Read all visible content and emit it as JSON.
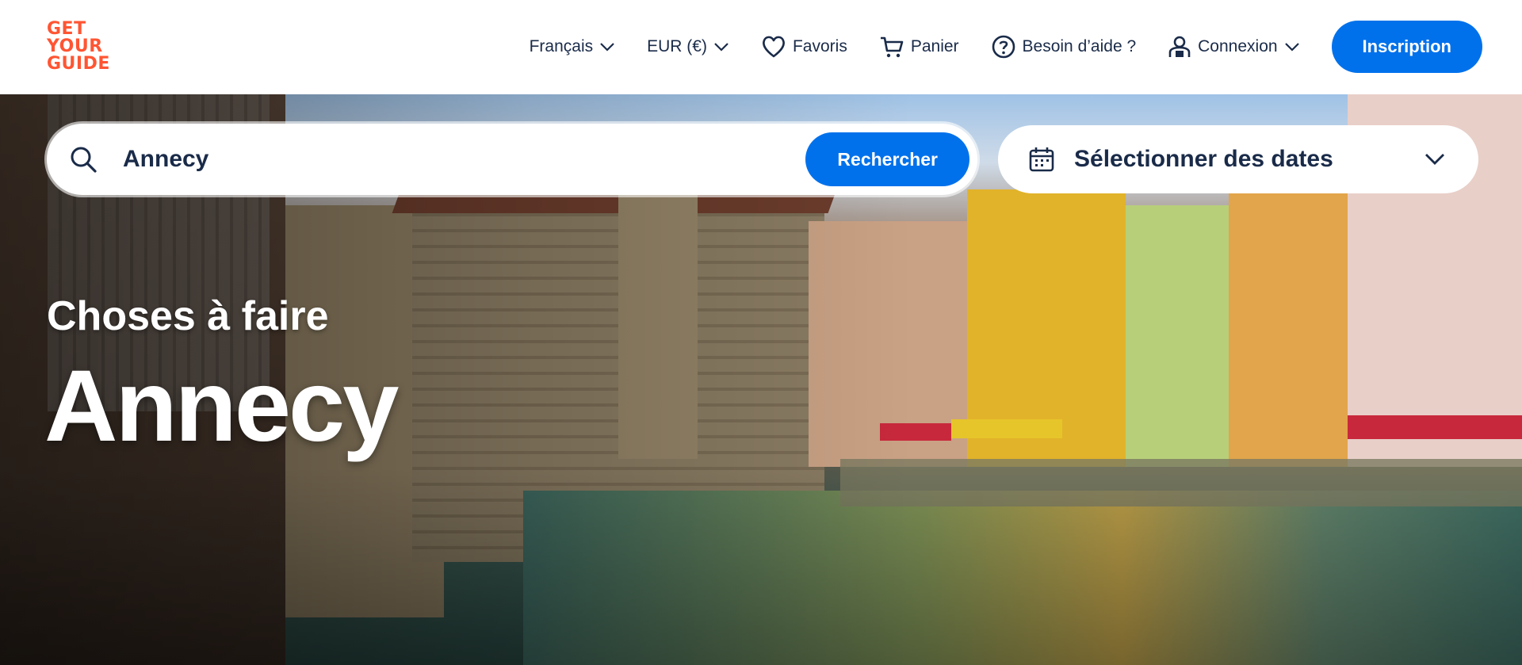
{
  "logo": {
    "line1": "GET",
    "line2": "YOUR",
    "line3": "GUIDE"
  },
  "nav": {
    "language": "Français",
    "currency": "EUR (€)",
    "favorites": "Favoris",
    "cart": "Panier",
    "help": "Besoin d’aide ?",
    "login": "Connexion",
    "signup": "Inscription"
  },
  "search": {
    "value": "Annecy",
    "button": "Rechercher",
    "dates": "Sélectionner des dates"
  },
  "hero": {
    "subtitle": "Choses à faire",
    "title": "Annecy"
  },
  "colors": {
    "brand": "#ff5533",
    "accent": "#0071eb",
    "text": "#1a2b49"
  }
}
